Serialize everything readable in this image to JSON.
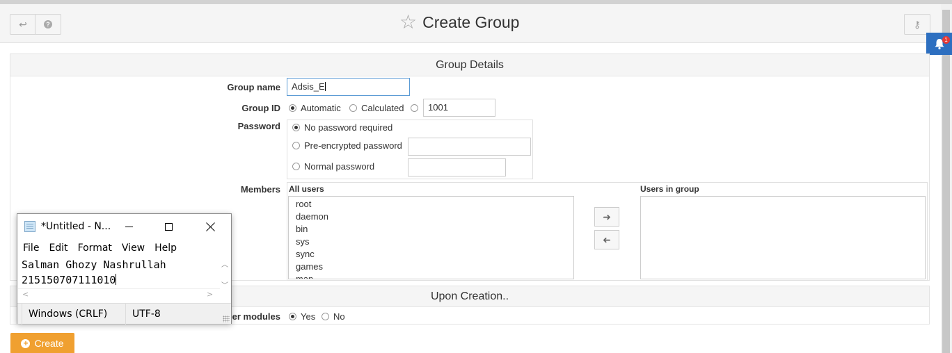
{
  "header": {
    "title": "Create Group",
    "back_icon": "↩",
    "help_icon": "?",
    "key_icon": "⚷"
  },
  "notifications": {
    "count": "1"
  },
  "group_details": {
    "heading": "Group Details",
    "group_name": {
      "label": "Group name",
      "value": "Adsis_E"
    },
    "group_id": {
      "label": "Group ID",
      "options": [
        "Automatic",
        "Calculated"
      ],
      "selected": "Automatic",
      "value": "1001"
    },
    "password": {
      "label": "Password",
      "options": [
        "No password required",
        "Pre-encrypted password",
        "Normal password"
      ],
      "selected": "No password required"
    },
    "members": {
      "label": "Members",
      "all_users_label": "All users",
      "users_in_group_label": "Users in group",
      "all_users": [
        "root",
        "daemon",
        "bin",
        "sys",
        "sync",
        "games",
        "man"
      ],
      "users_in_group": []
    }
  },
  "upon_creation": {
    "heading": "Upon Creation..",
    "other_modules_label_partial": "her modules",
    "options": [
      "Yes",
      "No"
    ],
    "selected": "Yes"
  },
  "create_button": {
    "label": "Create"
  },
  "notepad": {
    "title": "*Untitled - N...",
    "menu": [
      "File",
      "Edit",
      "Format",
      "View",
      "Help"
    ],
    "lines": [
      "Salman Ghozy Nashrullah",
      "215150707111010"
    ],
    "line_ending": "Windows (CRLF)",
    "encoding": "UTF-8"
  },
  "colors": {
    "create_button": "#f0a030",
    "notification": "#2d6fc0",
    "badge": "#e53935"
  }
}
